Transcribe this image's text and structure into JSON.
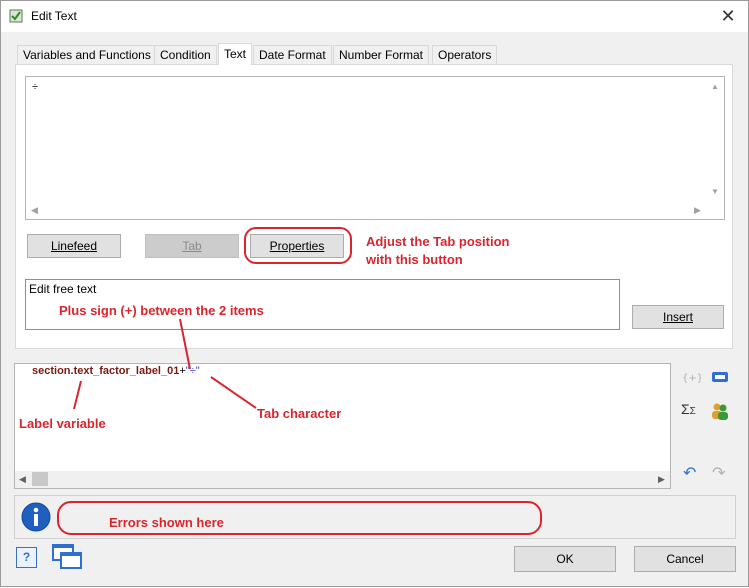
{
  "window": {
    "title": "Edit Text",
    "close_glyph": "✕"
  },
  "tabs": [
    {
      "label": "Variables and Functions",
      "active": false
    },
    {
      "label": "Condition",
      "active": false
    },
    {
      "label": "Text",
      "active": true
    },
    {
      "label": "Date Format",
      "active": false
    },
    {
      "label": "Number Format",
      "active": false
    },
    {
      "label": "Operators",
      "active": false
    }
  ],
  "text_editor": {
    "content": "÷"
  },
  "buttons": {
    "linefeed": "Linefeed",
    "tab": "Tab",
    "properties": "Properties",
    "insert": "Insert",
    "ok": "OK",
    "cancel": "Cancel"
  },
  "free_text": {
    "label": "Edit free text"
  },
  "formula": {
    "variable": "section.text_factor_label_01",
    "operator": "+",
    "string": "\"÷\""
  },
  "annotations": {
    "properties_note_1": "Adjust the Tab position",
    "properties_note_2": "with this button",
    "plus_note": "Plus sign (+) between the 2 items",
    "tab_char": "Tab character",
    "label_var": "Label variable",
    "errors": "Errors shown here"
  },
  "side_icons": {
    "sigma": "Σ",
    "undo": "↶",
    "redo": "↷",
    "help": "?"
  },
  "colors": {
    "annotation": "#d9252e",
    "variable_text": "#7a1a10",
    "string_text": "#2a3fd6",
    "info_icon": "#1f5fbf"
  }
}
